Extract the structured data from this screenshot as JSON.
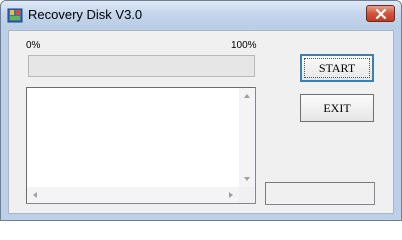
{
  "window": {
    "title": "Recovery Disk V3.0"
  },
  "progress": {
    "min_label": "0%",
    "max_label": "100%",
    "value_percent": 0
  },
  "buttons": {
    "start_label": "START",
    "exit_label": "EXIT"
  },
  "log": {
    "lines": []
  },
  "status": {
    "text": ""
  },
  "colors": {
    "close_button": "#c94a33",
    "progress_fill": "#37c837"
  },
  "icons": {
    "app": "recovery-disk-icon",
    "close": "close-icon",
    "scroll_up": "scroll-up-arrow-icon",
    "scroll_down": "scroll-down-arrow-icon",
    "scroll_left": "scroll-left-arrow-icon",
    "scroll_right": "scroll-right-arrow-icon"
  }
}
